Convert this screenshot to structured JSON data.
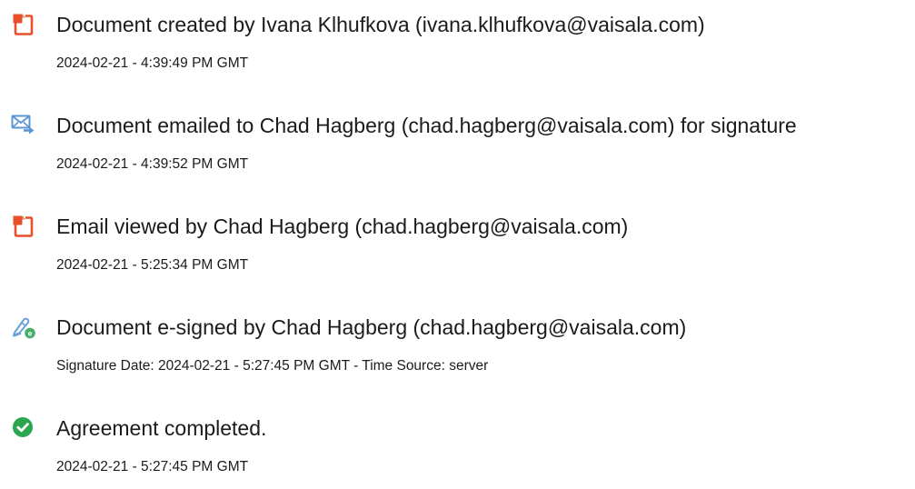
{
  "events": [
    {
      "icon": "document-created-icon",
      "title": "Document created by Ivana Klhufkova (ivana.klhufkova@vaisala.com)",
      "meta": "2024-02-21 - 4:39:49 PM GMT"
    },
    {
      "icon": "email-sent-icon",
      "title": "Document emailed to Chad Hagberg (chad.hagberg@vaisala.com) for signature",
      "meta": "2024-02-21 - 4:39:52 PM GMT"
    },
    {
      "icon": "document-viewed-icon",
      "title": "Email viewed by Chad Hagberg (chad.hagberg@vaisala.com)",
      "meta": "2024-02-21 - 5:25:34 PM GMT"
    },
    {
      "icon": "e-sign-pen-icon",
      "title": "Document e-signed by Chad Hagberg (chad.hagberg@vaisala.com)",
      "meta": "Signature Date: 2024-02-21 - 5:27:45 PM GMT - Time Source: server"
    },
    {
      "icon": "checkmark-circle-icon",
      "title": "Agreement completed.",
      "meta": "2024-02-21 - 5:27:45 PM GMT"
    }
  ],
  "colors": {
    "document_icon": "#e8502a",
    "email_icon": "#5a95d6",
    "pen_icon": "#43b06a",
    "check_icon": "#2aa64e"
  }
}
